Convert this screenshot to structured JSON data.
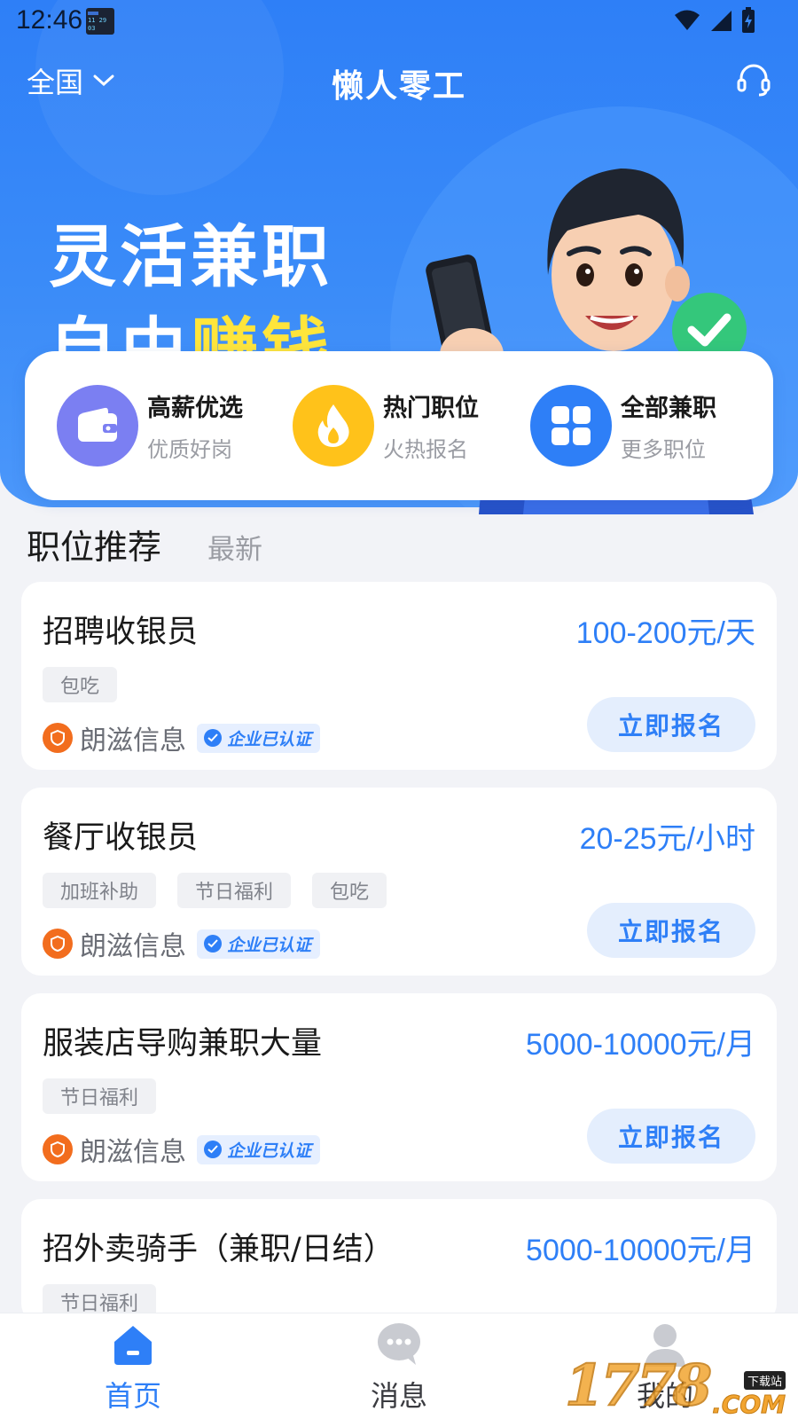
{
  "status_bar": {
    "time": "12:46",
    "widget_lines": [
      "11 29 03"
    ]
  },
  "topbar": {
    "region": "全国",
    "title": "懒人零工"
  },
  "banner": {
    "line1": "灵活兼职",
    "line2_prefix": "自由",
    "line2_highlight": "赚钱"
  },
  "quick_links": [
    {
      "title": "高薪优选",
      "subtitle": "优质好岗",
      "icon": "wallet-icon",
      "color": "#7b7ff2"
    },
    {
      "title": "热门职位",
      "subtitle": "火热报名",
      "icon": "flame-icon",
      "color": "#ffc21a"
    },
    {
      "title": "全部兼职",
      "subtitle": "更多职位",
      "icon": "grid-icon",
      "color": "#2e7ff7"
    }
  ],
  "section_tabs": {
    "active": "职位推荐",
    "inactive": "最新"
  },
  "jobs": [
    {
      "title": "招聘收银员",
      "salary": "100-200元/天",
      "tags": [
        "包吃"
      ],
      "company": "朗滋信息",
      "verified": "企业已认证",
      "apply": "立即报名"
    },
    {
      "title": "餐厅收银员",
      "salary": "20-25元/小时",
      "tags": [
        "加班补助",
        "节日福利",
        "包吃"
      ],
      "company": "朗滋信息",
      "verified": "企业已认证",
      "apply": "立即报名"
    },
    {
      "title": "服装店导购兼职大量",
      "salary": "5000-10000元/月",
      "tags": [
        "节日福利"
      ],
      "company": "朗滋信息",
      "verified": "企业已认证",
      "apply": "立即报名"
    },
    {
      "title": "招外卖骑手（兼职/日结）",
      "salary": "5000-10000元/月",
      "tags": [
        "节日福利"
      ]
    }
  ],
  "bottom_nav": [
    {
      "label": "首页",
      "icon": "home-icon",
      "active": true
    },
    {
      "label": "消息",
      "icon": "chat-icon",
      "active": false
    },
    {
      "label": "我的",
      "icon": "user-icon",
      "active": false
    }
  ],
  "watermark": {
    "number": "1778",
    "small": "下载站",
    "com": ".COM"
  },
  "colors": {
    "primary": "#2e7ff7",
    "highlight": "#ffe53b"
  }
}
